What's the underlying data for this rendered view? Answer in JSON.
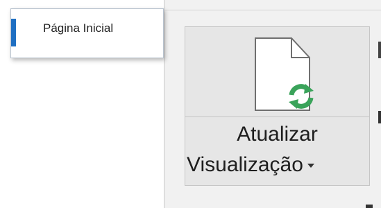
{
  "tab": {
    "label": "Página Inicial"
  },
  "ribbon": {
    "refresh_button": {
      "line1": "Atualizar",
      "line2": "Visualização",
      "icon": "document-refresh-icon"
    }
  },
  "colors": {
    "tab_accent": "#1f6fc2",
    "refresh_green": "#3aa35a",
    "ribbon_bg": "#f1f1f1"
  }
}
